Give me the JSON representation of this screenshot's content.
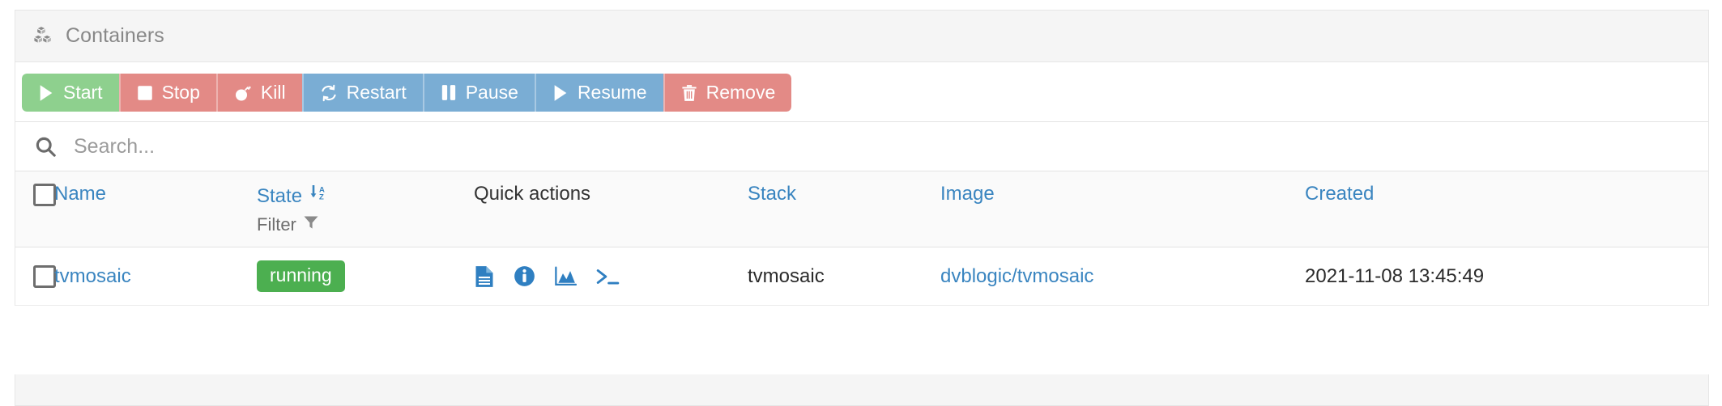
{
  "panel": {
    "title": "Containers",
    "title_icon": "cubes-icon"
  },
  "toolbar": {
    "buttons": [
      {
        "label": "Start",
        "icon": "play-icon",
        "color": "#8ed08e",
        "style": "green"
      },
      {
        "label": "Stop",
        "icon": "square-icon",
        "color": "#e38a86",
        "style": "red"
      },
      {
        "label": "Kill",
        "icon": "bomb-icon",
        "color": "#e38a86",
        "style": "red"
      },
      {
        "label": "Restart",
        "icon": "refresh-icon",
        "color": "#7aadd4",
        "style": "blue"
      },
      {
        "label": "Pause",
        "icon": "pause-icon",
        "color": "#7aadd4",
        "style": "blue"
      },
      {
        "label": "Resume",
        "icon": "play-icon",
        "color": "#7aadd4",
        "style": "blue"
      },
      {
        "label": "Remove",
        "icon": "trash-icon",
        "color": "#e38a86",
        "style": "red"
      }
    ]
  },
  "search": {
    "icon": "search-icon",
    "value": "",
    "placeholder": "Search..."
  },
  "table": {
    "headers": {
      "select_all": "",
      "name": "Name",
      "state": "State",
      "state_sort_icon": "sort-alpha-down-icon",
      "filter_label": "Filter",
      "filter_icon": "funnel-icon",
      "quick_actions": "Quick actions",
      "stack": "Stack",
      "image": "Image",
      "created": "Created"
    },
    "rows": [
      {
        "selected": false,
        "name": "tvmosaic",
        "state": "running",
        "state_color": "#4caf50",
        "quick_actions": [
          {
            "name": "logs-icon"
          },
          {
            "name": "inspect-info-icon"
          },
          {
            "name": "stats-chart-icon"
          },
          {
            "name": "console-terminal-icon"
          }
        ],
        "stack": "tvmosaic",
        "image": "dvblogic/tvmosaic",
        "created": "2021-11-08 13:45:49"
      }
    ]
  },
  "colors": {
    "link": "#3a85c0",
    "header_bg": "#f5f5f5",
    "badge_running": "#4caf50"
  }
}
